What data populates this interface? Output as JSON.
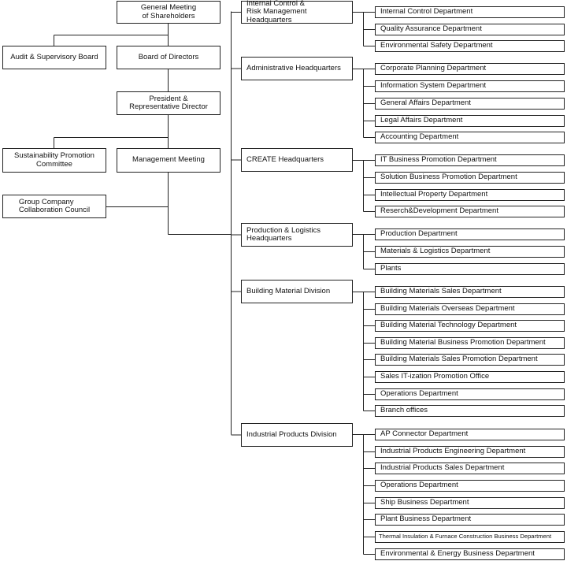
{
  "governance": {
    "shareholders": "General Meeting\nof Shareholders",
    "audit_board": "Audit & Supervisory Board",
    "board_of_directors": "Board of Directors",
    "president": "President &\nRepresentative Director",
    "sustainability": "Sustainability Promotion\nCommittee",
    "management_meeting": "Management Meeting",
    "group_council": "Group Company\nCollaboration Council"
  },
  "headquarters": [
    {
      "name": "Internal Control &\nRisk Management Headquarters",
      "departments": [
        "Internal Control Department",
        "Quality Assurance Department",
        "Environmental Safety Department"
      ]
    },
    {
      "name": "Administrative Headquarters",
      "departments": [
        "Corporate Planning Department",
        "Information System Department",
        "General Affairs Department",
        "Legal Affairs Department",
        "Accounting Department"
      ]
    },
    {
      "name": "CREATE Headquarters",
      "departments": [
        "IT Business Promotion Department",
        "Solution Business Promotion Department",
        "Intellectual Property Department",
        "Reserch&Development Department"
      ]
    },
    {
      "name": "Production & Logistics\nHeadquarters",
      "departments": [
        "Production Department",
        "Materials & Logistics Department",
        "Plants"
      ]
    },
    {
      "name": "Building Material Division",
      "departments": [
        "Building Materials Sales Department",
        "Building Materials Overseas Department",
        "Building Material Technology Department",
        "Building Material Business Promotion Department",
        "Building Materials Sales Promotion Department",
        "Sales IT-ization Promotion Office",
        "Operations Department",
        "Branch offices"
      ]
    },
    {
      "name": "Industrial Products Division",
      "departments": [
        "AP Connector Department",
        "Industrial Products Engineering Department",
        "Industrial Products Sales Department",
        "Operations Department",
        "Ship Business Department",
        "Plant Business Department",
        "Thermal Insulation & Furnace Construction Business Department",
        "Environmental & Energy Business Department"
      ]
    }
  ]
}
